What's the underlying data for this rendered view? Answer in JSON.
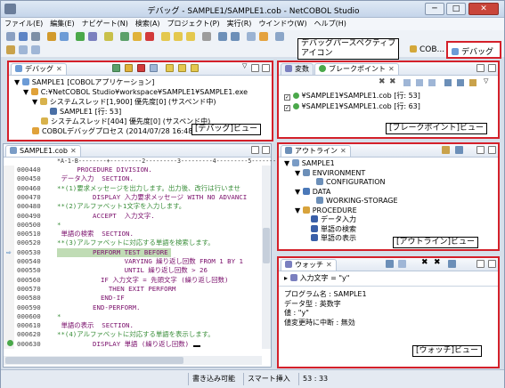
{
  "window": {
    "title": "デバッグ - SAMPLE1/SAMPLE1.cob - NetCOBOL Studio",
    "minimize": "─",
    "maximize": "□",
    "close": "✕"
  },
  "menu": [
    "ファイル(E)",
    "編集(E)",
    "ナビゲート(N)",
    "検索(A)",
    "プロジェクト(P)",
    "実行(R)",
    "ウインドウ(W)",
    "ヘルプ(H)"
  ],
  "perspective": {
    "callout_line1": "デバッグパースペクティブ",
    "callout_line2": "アイコン",
    "cobol_label": "COB...",
    "debug_label": "デバッグ"
  },
  "debug_view": {
    "tab": "デバッグ",
    "items": [
      "SAMPLE1 [COBOLアプリケーション]",
      "C:¥NetCOBOL Studio¥workspace¥SAMPLE1¥SAMPLE1.exe",
      "システムスレッド[1,900] 優先度[0] (サスペンド中)",
      "SAMPLE1 [行: 53]",
      "システムスレッド[404] 優先度[0] (サスペンド中)",
      "COBOLデバッグプロセス (2014/07/28 16:48:32)"
    ],
    "caption": "[デバッグ]ビュー"
  },
  "breakpoint_view": {
    "tab_var": "変数",
    "tab": "ブレークポイント",
    "items": [
      "¥SAMPLE1¥SAMPLE1.cob [行: 53]",
      "¥SAMPLE1¥SAMPLE1.cob [行: 63]"
    ],
    "caption": "[ブレークポイント]ビュー"
  },
  "editor": {
    "tab": "SAMPLE1.cob",
    "ruler": "*A-1-B--------+---------2---------3---------4---------5---------6-",
    "lines": [
      {
        "n": "000440",
        "t": "     PROCEDURE DIVISION."
      },
      {
        "n": "000450",
        "t": " データ入力  SECTION."
      },
      {
        "n": "000460",
        "t": "**(1)要求メッセージを出力します。出力後、改行は行いませ"
      },
      {
        "n": "000470",
        "t": "         DISPLAY 入力要求メッセージ WITH NO ADVANCI"
      },
      {
        "n": "000480",
        "t": "**(2)アルファベット1文字を入力します。"
      },
      {
        "n": "000490",
        "t": "         ACCEPT  入力文字."
      },
      {
        "n": "000500",
        "t": "*"
      },
      {
        "n": "000510",
        "t": " 単語の検索  SECTION."
      },
      {
        "n": "000520",
        "t": "**(3)アルファベットに対応する単語を検索します。"
      },
      {
        "n": "000530",
        "t": "         PERFORM TEST BEFORE"
      },
      {
        "n": "000540",
        "t": "                 VARYING 繰り返し回数 FROM 1 BY 1"
      },
      {
        "n": "000550",
        "t": "                 UNTIL 繰り返し回数 > 26"
      },
      {
        "n": "000560",
        "t": "           IF 入力文字 = 先頭文字 (繰り返し回数)"
      },
      {
        "n": "000570",
        "t": "             THEN EXIT PERFORM"
      },
      {
        "n": "000580",
        "t": "           END-IF"
      },
      {
        "n": "000590",
        "t": "         END-PERFORM."
      },
      {
        "n": "000600",
        "t": "*"
      },
      {
        "n": "000610",
        "t": " 単語の表示  SECTION."
      },
      {
        "n": "000620",
        "t": "**(4)アルファベットに対応する単語を表示します。"
      },
      {
        "n": "000630",
        "t": "         DISPLAY 単語 (繰り返し回数)"
      }
    ]
  },
  "outline_view": {
    "tab": "アウトライン",
    "items": [
      "SAMPLE1",
      "ENVIRONMENT",
      "CONFIGURATION",
      "DATA",
      "WORKING-STORAGE",
      "PROCEDURE",
      "データ入力",
      "単語の検索",
      "単語の表示"
    ],
    "caption": "[アウトライン]ビュー"
  },
  "watch_view": {
    "tab": "ウォッチ",
    "expr": "入力文字 = \"y\"",
    "details": [
      "プログラム名 : SAMPLE1",
      "データ型 : 英数字",
      "値 : \"y\"",
      "値変更時に中断 : 無効"
    ],
    "caption": "[ウォッチ]ビュー"
  },
  "status": {
    "writable": "書き込み可能",
    "insert": "スマート挿入",
    "position": "53 : 33"
  },
  "colors": {
    "highlight": "#c0dcb5",
    "red": "#d4202a",
    "comment": "#3a8e3a",
    "keyword": "#7a0f6b"
  }
}
